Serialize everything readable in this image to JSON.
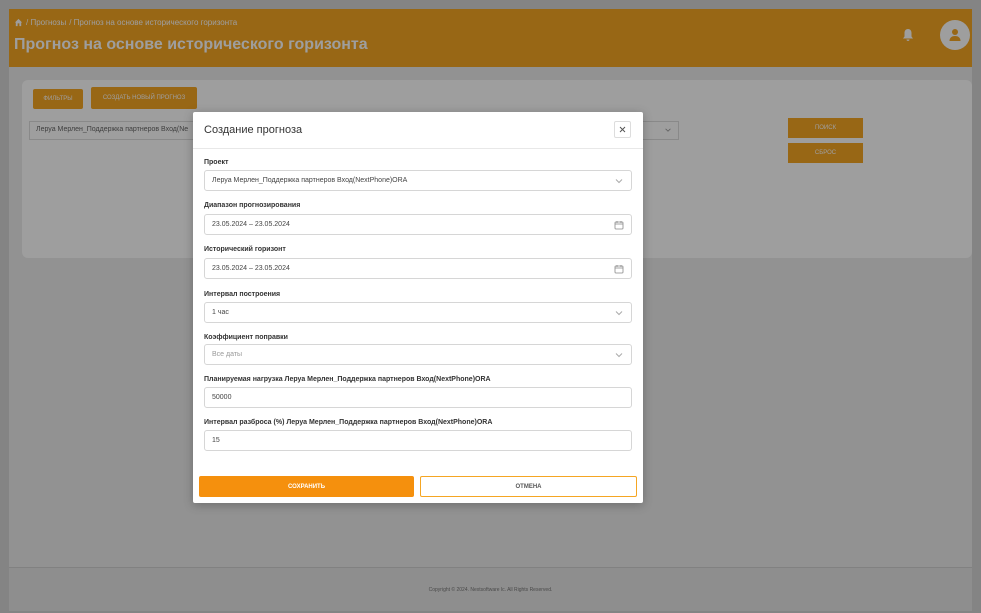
{
  "header": {
    "breadcrumb": [
      "/ Прогнозы",
      "/ Прогноз на основе исторического горизонта"
    ],
    "title": "Прогноз на основе исторического горизонта"
  },
  "toolbar": {
    "filters_label": "ФИЛЬТРЫ",
    "new_forecast_label": "СОЗДАТЬ НОВЫЙ ПРОГНОЗ",
    "project_value": "Леруа Мерлен_Поддержка партнеров Вход(Ne",
    "search_label": "ПОИСК",
    "reset_label": "СБРОС"
  },
  "footer": {
    "copyright": "Copyright © 2024. Nextsoftware lc. All Rights Reserved."
  },
  "modal": {
    "title": "Создание прогноза",
    "fields": [
      {
        "label": "Проект",
        "value": "Леруа Мерлен_Поддержка партнеров Вход(NextPhone)ORA",
        "icon": "chevron-down-icon"
      },
      {
        "label": "Диапазон прогнозирования",
        "value": "23.05.2024 – 23.05.2024",
        "icon": "calendar-icon"
      },
      {
        "label": "Исторический горизонт",
        "value": "23.05.2024 – 23.05.2024",
        "icon": "calendar-icon"
      },
      {
        "label": "Интервал построения",
        "value": "1 час",
        "icon": "chevron-down-icon"
      },
      {
        "label": "Коэффициент поправки",
        "placeholder": "Все даты",
        "icon": "chevron-down-icon"
      },
      {
        "label": "Планируемая нагрузка Леруа Мерлен_Поддержка партнеров Вход(NextPhone)ORA",
        "value": "50000"
      },
      {
        "label": "Интервал разброса (%) Леруа Мерлен_Поддержка партнеров Вход(NextPhone)ORA",
        "value": "15"
      }
    ],
    "save_label": "СОХРАНИТЬ",
    "cancel_label": "ОТМЕНА"
  },
  "colors": {
    "accent": "#f5a623",
    "save_button": "#f5900d"
  }
}
